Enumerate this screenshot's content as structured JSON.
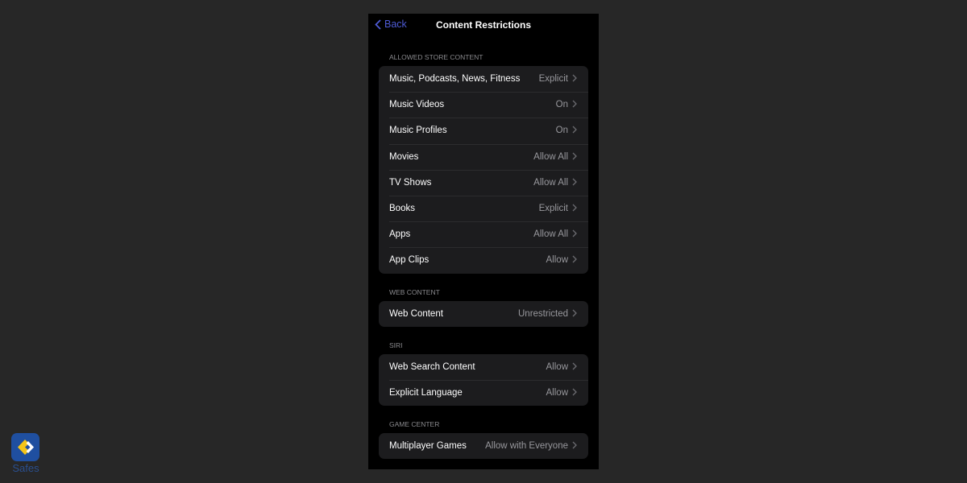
{
  "nav": {
    "back_label": "Back",
    "title": "Content Restrictions"
  },
  "sections": [
    {
      "header": "ALLOWED STORE CONTENT",
      "rows": [
        {
          "label": "Music, Podcasts, News, Fitness",
          "value": "Explicit"
        },
        {
          "label": "Music Videos",
          "value": "On"
        },
        {
          "label": "Music Profiles",
          "value": "On"
        },
        {
          "label": "Movies",
          "value": "Allow All"
        },
        {
          "label": "TV Shows",
          "value": "Allow All"
        },
        {
          "label": "Books",
          "value": "Explicit"
        },
        {
          "label": "Apps",
          "value": "Allow All"
        },
        {
          "label": "App Clips",
          "value": "Allow"
        }
      ]
    },
    {
      "header": "WEB CONTENT",
      "rows": [
        {
          "label": "Web Content",
          "value": "Unrestricted"
        }
      ]
    },
    {
      "header": "SIRI",
      "rows": [
        {
          "label": "Web Search Content",
          "value": "Allow"
        },
        {
          "label": "Explicit Language",
          "value": "Allow"
        }
      ]
    },
    {
      "header": "GAME CENTER",
      "rows": [
        {
          "label": "Multiplayer Games",
          "value": "Allow with Everyone"
        }
      ]
    }
  ],
  "watermark": {
    "text": "Safes"
  },
  "colors": {
    "accent": "#4e5bd6",
    "background": "#272727"
  }
}
